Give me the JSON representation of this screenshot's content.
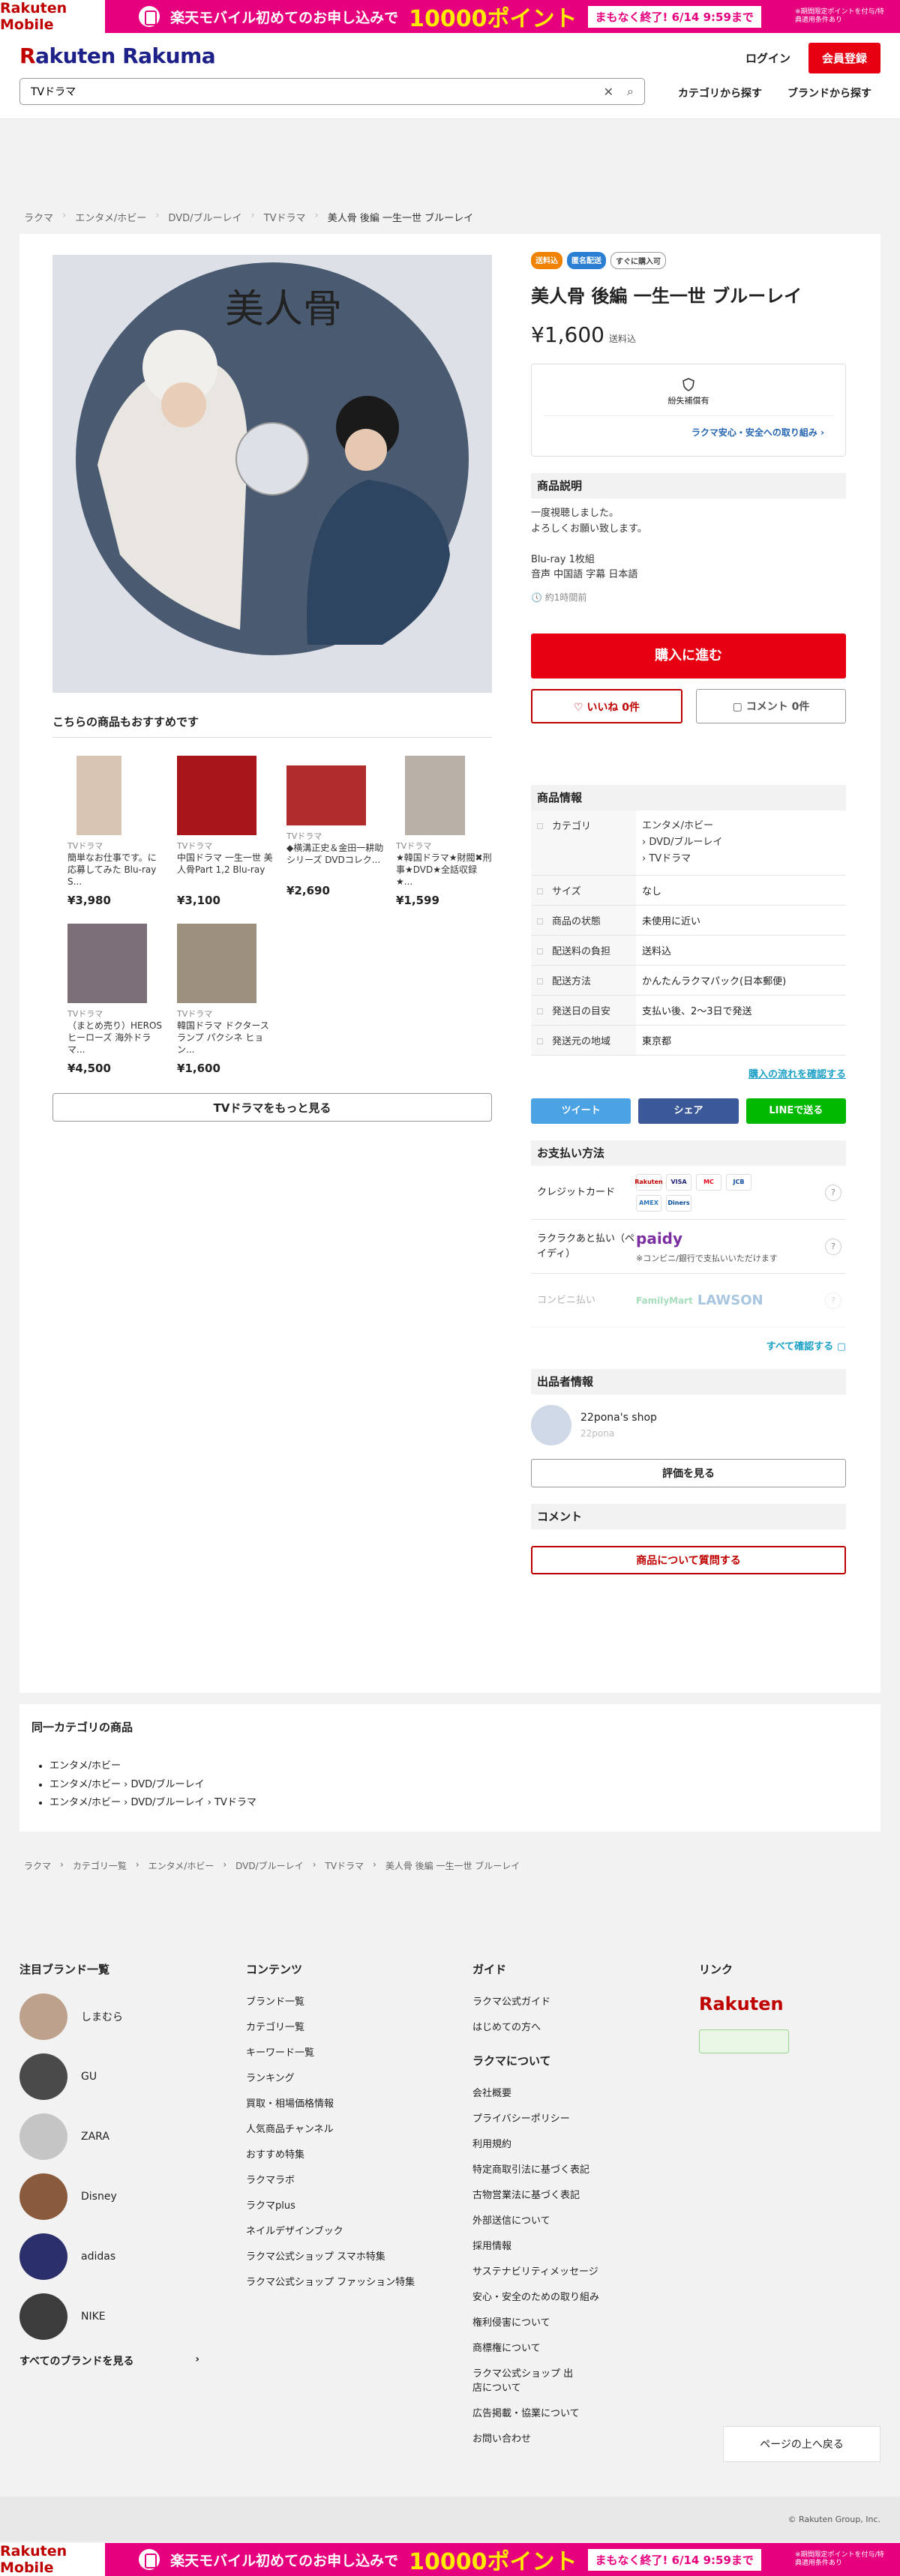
{
  "banner": {
    "logo": "Rakuten Mobile",
    "text": "楽天モバイル初めてのお申し込みで",
    "points": "10000ポイント",
    "ending": "まもなく終了! 6/14 9:59まで",
    "note": "※期間限定ポイントを付与/特典適用条件あり"
  },
  "header": {
    "brand_r": "R",
    "brand_rest": "akuten Rakuma",
    "login": "ログイン",
    "signup": "会員登録",
    "search_value": "TVドラマ",
    "clear_icon": "✕",
    "search_icon": "⌕",
    "cat_link": "カテゴリから探す",
    "brand_link": "ブランドから探す"
  },
  "breadcrumb": [
    "ラクマ",
    "エンタメ/ホビー",
    "DVD/ブルーレイ",
    "TVドラマ",
    "美人骨 後編 一生一世 ブルーレイ"
  ],
  "product": {
    "badges": [
      "送料込",
      "匿名配送",
      "すぐに購入可"
    ],
    "title": "美人骨 後編 一生一世 ブルーレイ",
    "price": "¥1,600",
    "price_note": "送料込",
    "safe_caption": "紛失補償有",
    "safe_link": "ラクマ安心・安全への取り組み",
    "desc_heading": "商品説明",
    "desc_lines": [
      "一度視聴しました。",
      "よろしくお願い致します。",
      "",
      "Blu-ray  1枚組",
      "音声  中国語   字幕  日本語"
    ],
    "ago": "約1時間前",
    "buy": "購入に進む",
    "like": "いいね 0件",
    "comment": "コメント 0件",
    "disc_title": "美人骨"
  },
  "recommend": {
    "title": "こちらの商品もおすすめです",
    "items": [
      {
        "cat": "TVドラマ",
        "name": "簡単なお仕事です。に応募してみた Blu-ray S...",
        "price": "¥3,980"
      },
      {
        "cat": "TVドラマ",
        "name": "中国ドラマ 一生一世 美人骨Part 1,2 Blu-ray",
        "price": "¥3,100"
      },
      {
        "cat": "TVドラマ",
        "name": "◆横溝正史＆金田一耕助シリーズ DVDコレク...",
        "price": "¥2,690"
      },
      {
        "cat": "TVドラマ",
        "name": "★韓国ドラマ★財閥✖刑事★DVD★全話収録★...",
        "price": "¥1,599"
      },
      {
        "cat": "TVドラマ",
        "name": "（まとめ売り）HEROS ヒーローズ 海外ドラマ...",
        "price": "¥4,500"
      },
      {
        "cat": "TVドラマ",
        "name": "韓国ドラマ ドクタースランプ パクシネ ヒョン...",
        "price": "¥1,600"
      }
    ],
    "more": "TVドラマをもっと見る"
  },
  "info": {
    "heading": "商品情報",
    "rows": [
      {
        "k": "カテゴリ",
        "v": "エンタメ/ホビー\n› DVD/ブルーレイ\n› TVドラマ"
      },
      {
        "k": "サイズ",
        "v": "なし"
      },
      {
        "k": "商品の状態",
        "v": "未使用に近い"
      },
      {
        "k": "配送料の負担",
        "v": "送料込"
      },
      {
        "k": "配送方法",
        "v": "かんたんラクマパック(日本郵便)"
      },
      {
        "k": "発送日の目安",
        "v": "支払い後、2〜3日で発送"
      },
      {
        "k": "発送元の地域",
        "v": "東京都"
      }
    ],
    "flow": "購入の流れを確認する"
  },
  "share": {
    "twitter": "ツイート",
    "facebook": "シェア",
    "line": "LINEで送る"
  },
  "payment": {
    "heading": "お支払い方法",
    "credit": "クレジットカード",
    "cards": [
      "Rakuten",
      "VISA",
      "MC",
      "JCB",
      "AMEX",
      "Diners"
    ],
    "later": "ラクラクあと払い（ペイディ）",
    "paidy": "paidy",
    "paidy_note": "※コンビニ/銀行で支払いいただけます",
    "konbini": "コンビニ払い",
    "konbini_logos": [
      "FamilyMart",
      "LAWSON"
    ],
    "all": "すべて確認する"
  },
  "seller": {
    "heading": "出品者情報",
    "name": "22pona's shop",
    "id": "22pona",
    "eval": "評価を見る"
  },
  "comment": {
    "heading": "コメント",
    "ask": "商品について質問する"
  },
  "samecat": {
    "title": "同一カテゴリの商品",
    "items": [
      "エンタメ/ホビー",
      "エンタメ/ホビー › DVD/ブルーレイ",
      "エンタメ/ホビー › DVD/ブルーレイ › TVドラマ"
    ]
  },
  "breadcrumb2": [
    "ラクマ",
    "カテゴリ一覧",
    "エンタメ/ホビー",
    "DVD/ブルーレイ",
    "TVドラマ",
    "美人骨 後編 一生一世 ブルーレイ"
  ],
  "footer": {
    "brands_heading": "注目ブランド一覧",
    "brands": [
      "しまむら",
      "GU",
      "ZARA",
      "Disney",
      "adidas",
      "NIKE"
    ],
    "all_brands": "すべてのブランドを見る",
    "contents_heading": "コンテンツ",
    "contents": [
      "ブランド一覧",
      "カテゴリ一覧",
      "キーワード一覧",
      "ランキング",
      "買取・相場価格情報",
      "人気商品チャンネル",
      "おすすめ特集",
      "ラクマラボ",
      "ラクマplus",
      "ネイルデザインブック",
      "ラクマ公式ショップ スマホ特集",
      "ラクマ公式ショップ ファッション特集"
    ],
    "guide_heading": "ガイド",
    "guide": [
      "ラクマ公式ガイド",
      "はじめての方へ"
    ],
    "about_heading": "ラクマについて",
    "about": [
      "会社概要",
      "プライバシーポリシー",
      "利用規約",
      "特定商取引法に基づく表記",
      "古物営業法に基づく表記",
      "外部送信について",
      "採用情報",
      "サステナビリティメッセージ",
      "安心・安全のための取り組み",
      "権利侵害について",
      "商標権について",
      "ラクマ公式ショップ 出店について",
      "広告掲載・協業について",
      "お問い合わせ"
    ],
    "link_heading": "リンク",
    "rakuten_logo": "Rakuten",
    "top": "ページの上へ戻る",
    "copyright": "© Rakuten Group, Inc."
  }
}
